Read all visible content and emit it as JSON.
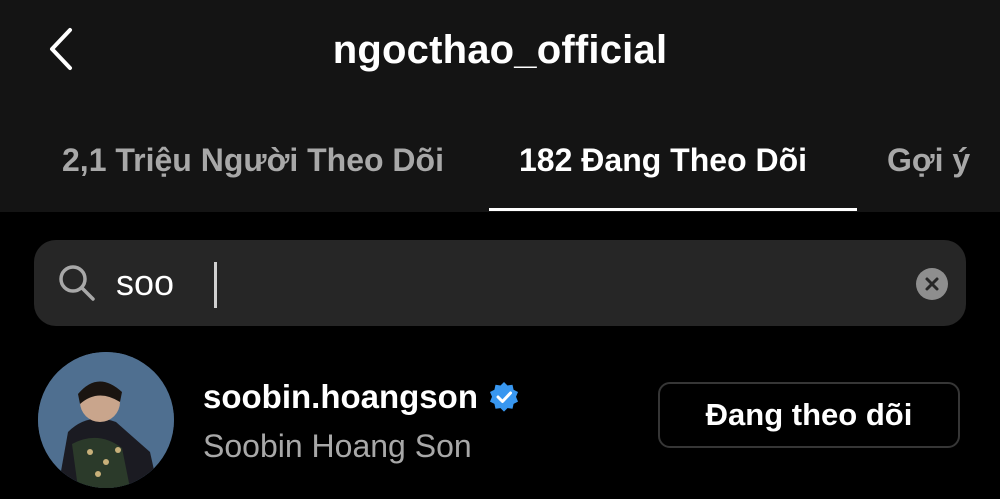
{
  "header": {
    "title": "ngocthao_official",
    "back_icon": "chevron-left-icon"
  },
  "tabs": [
    {
      "label": "2,1 Triệu Người Theo Dõi",
      "active": false
    },
    {
      "label": "182 Đang Theo Dõi",
      "active": true
    },
    {
      "label": "Gợi ý",
      "active": false
    }
  ],
  "search": {
    "value": "soo",
    "search_icon": "search-icon",
    "clear_icon": "clear-icon"
  },
  "results": [
    {
      "username": "soobin.hoangson",
      "verified": true,
      "full_name": "Soobin Hoang Son",
      "button_label": "Đang theo dõi"
    }
  ],
  "colors": {
    "background": "#000000",
    "header_bg": "#141414",
    "search_bg": "#262626",
    "text_primary": "#ffffff",
    "text_secondary": "#a8a8a8",
    "verified_blue": "#3897f0",
    "button_border": "#363636"
  }
}
